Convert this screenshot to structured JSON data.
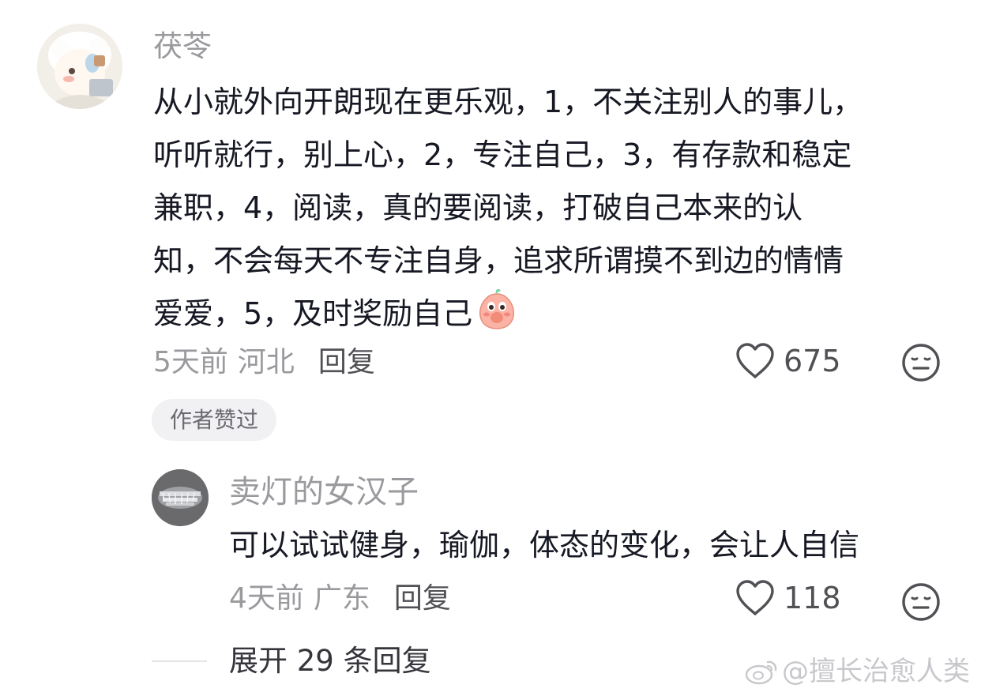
{
  "comment": {
    "username": "茯苓",
    "text_lines": [
      "从小就外向开朗现在更乐观，1，不关注别人的事儿，",
      "听听就行，别上心，2，专注自己，3，有存款和稳定",
      "兼职，4，阅读，真的要阅读，打破自己本来的认",
      "知，不会每天不专注自身，追求所谓摸不到边的情情",
      "爱爱，5，及时奖励自己"
    ],
    "emoji": "peach-blush-emoji",
    "time": "5天前",
    "location": "河北",
    "reply_label": "回复",
    "like_count": "675",
    "author_badge": "作者赞过"
  },
  "reply": {
    "username": "卖灯的女汉子",
    "text": "可以试试健身，瑜伽，体态的变化，会让人自信",
    "time": "4天前",
    "location": "广东",
    "reply_label": "回复",
    "like_count": "118"
  },
  "expand_replies_label": "展开 29 条回复",
  "watermark": "@擅长治愈人类",
  "icons": {
    "like": "heart-outline-icon",
    "dislike": "meh-face-icon",
    "watermark_logo": "weibo-logo-icon"
  }
}
